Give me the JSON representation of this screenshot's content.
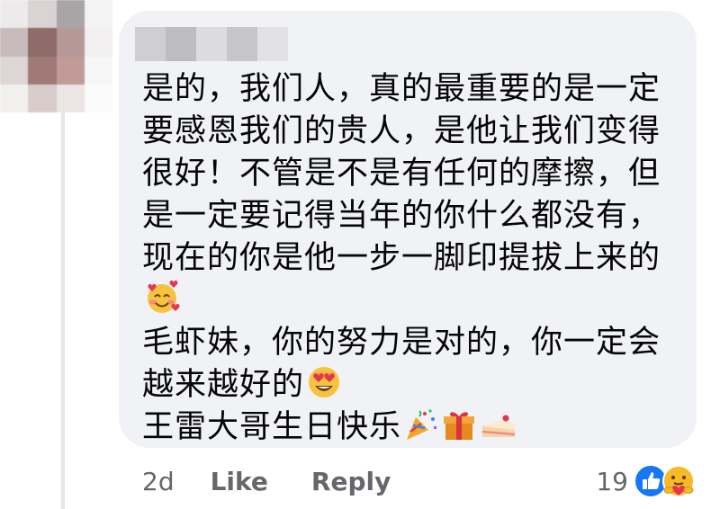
{
  "comment": {
    "lines": [
      "是的，我们人，真的最重要的是一定",
      "要感恩我们的贵人，是他让我们变得",
      "很好！不管是不是有任何的摩擦，但",
      "是一定要记得当年的你什么都没有，",
      "现在的你是他一步一脚印提拔上来的",
      "",
      "毛虾妹，你的努力是对的，你一定会",
      "越来越好的",
      "王雷大哥生日快乐"
    ],
    "emojis": {
      "line6": "smiling-face-with-hearts-icon",
      "line8": "heart-eyes-icon",
      "line9": [
        "party-popper-icon",
        "gift-icon",
        "cake-icon"
      ]
    }
  },
  "footer": {
    "time": "2d",
    "like_label": "Like",
    "reply_label": "Reply",
    "reaction_count": "19",
    "reactions": [
      "like-reaction-icon",
      "care-reaction-icon"
    ]
  },
  "colors": {
    "bubble": "#f0f2f5",
    "text": "#050505",
    "muted": "#65676b",
    "like_blue": "#1877f2",
    "care_yellow": "#f7b928"
  }
}
